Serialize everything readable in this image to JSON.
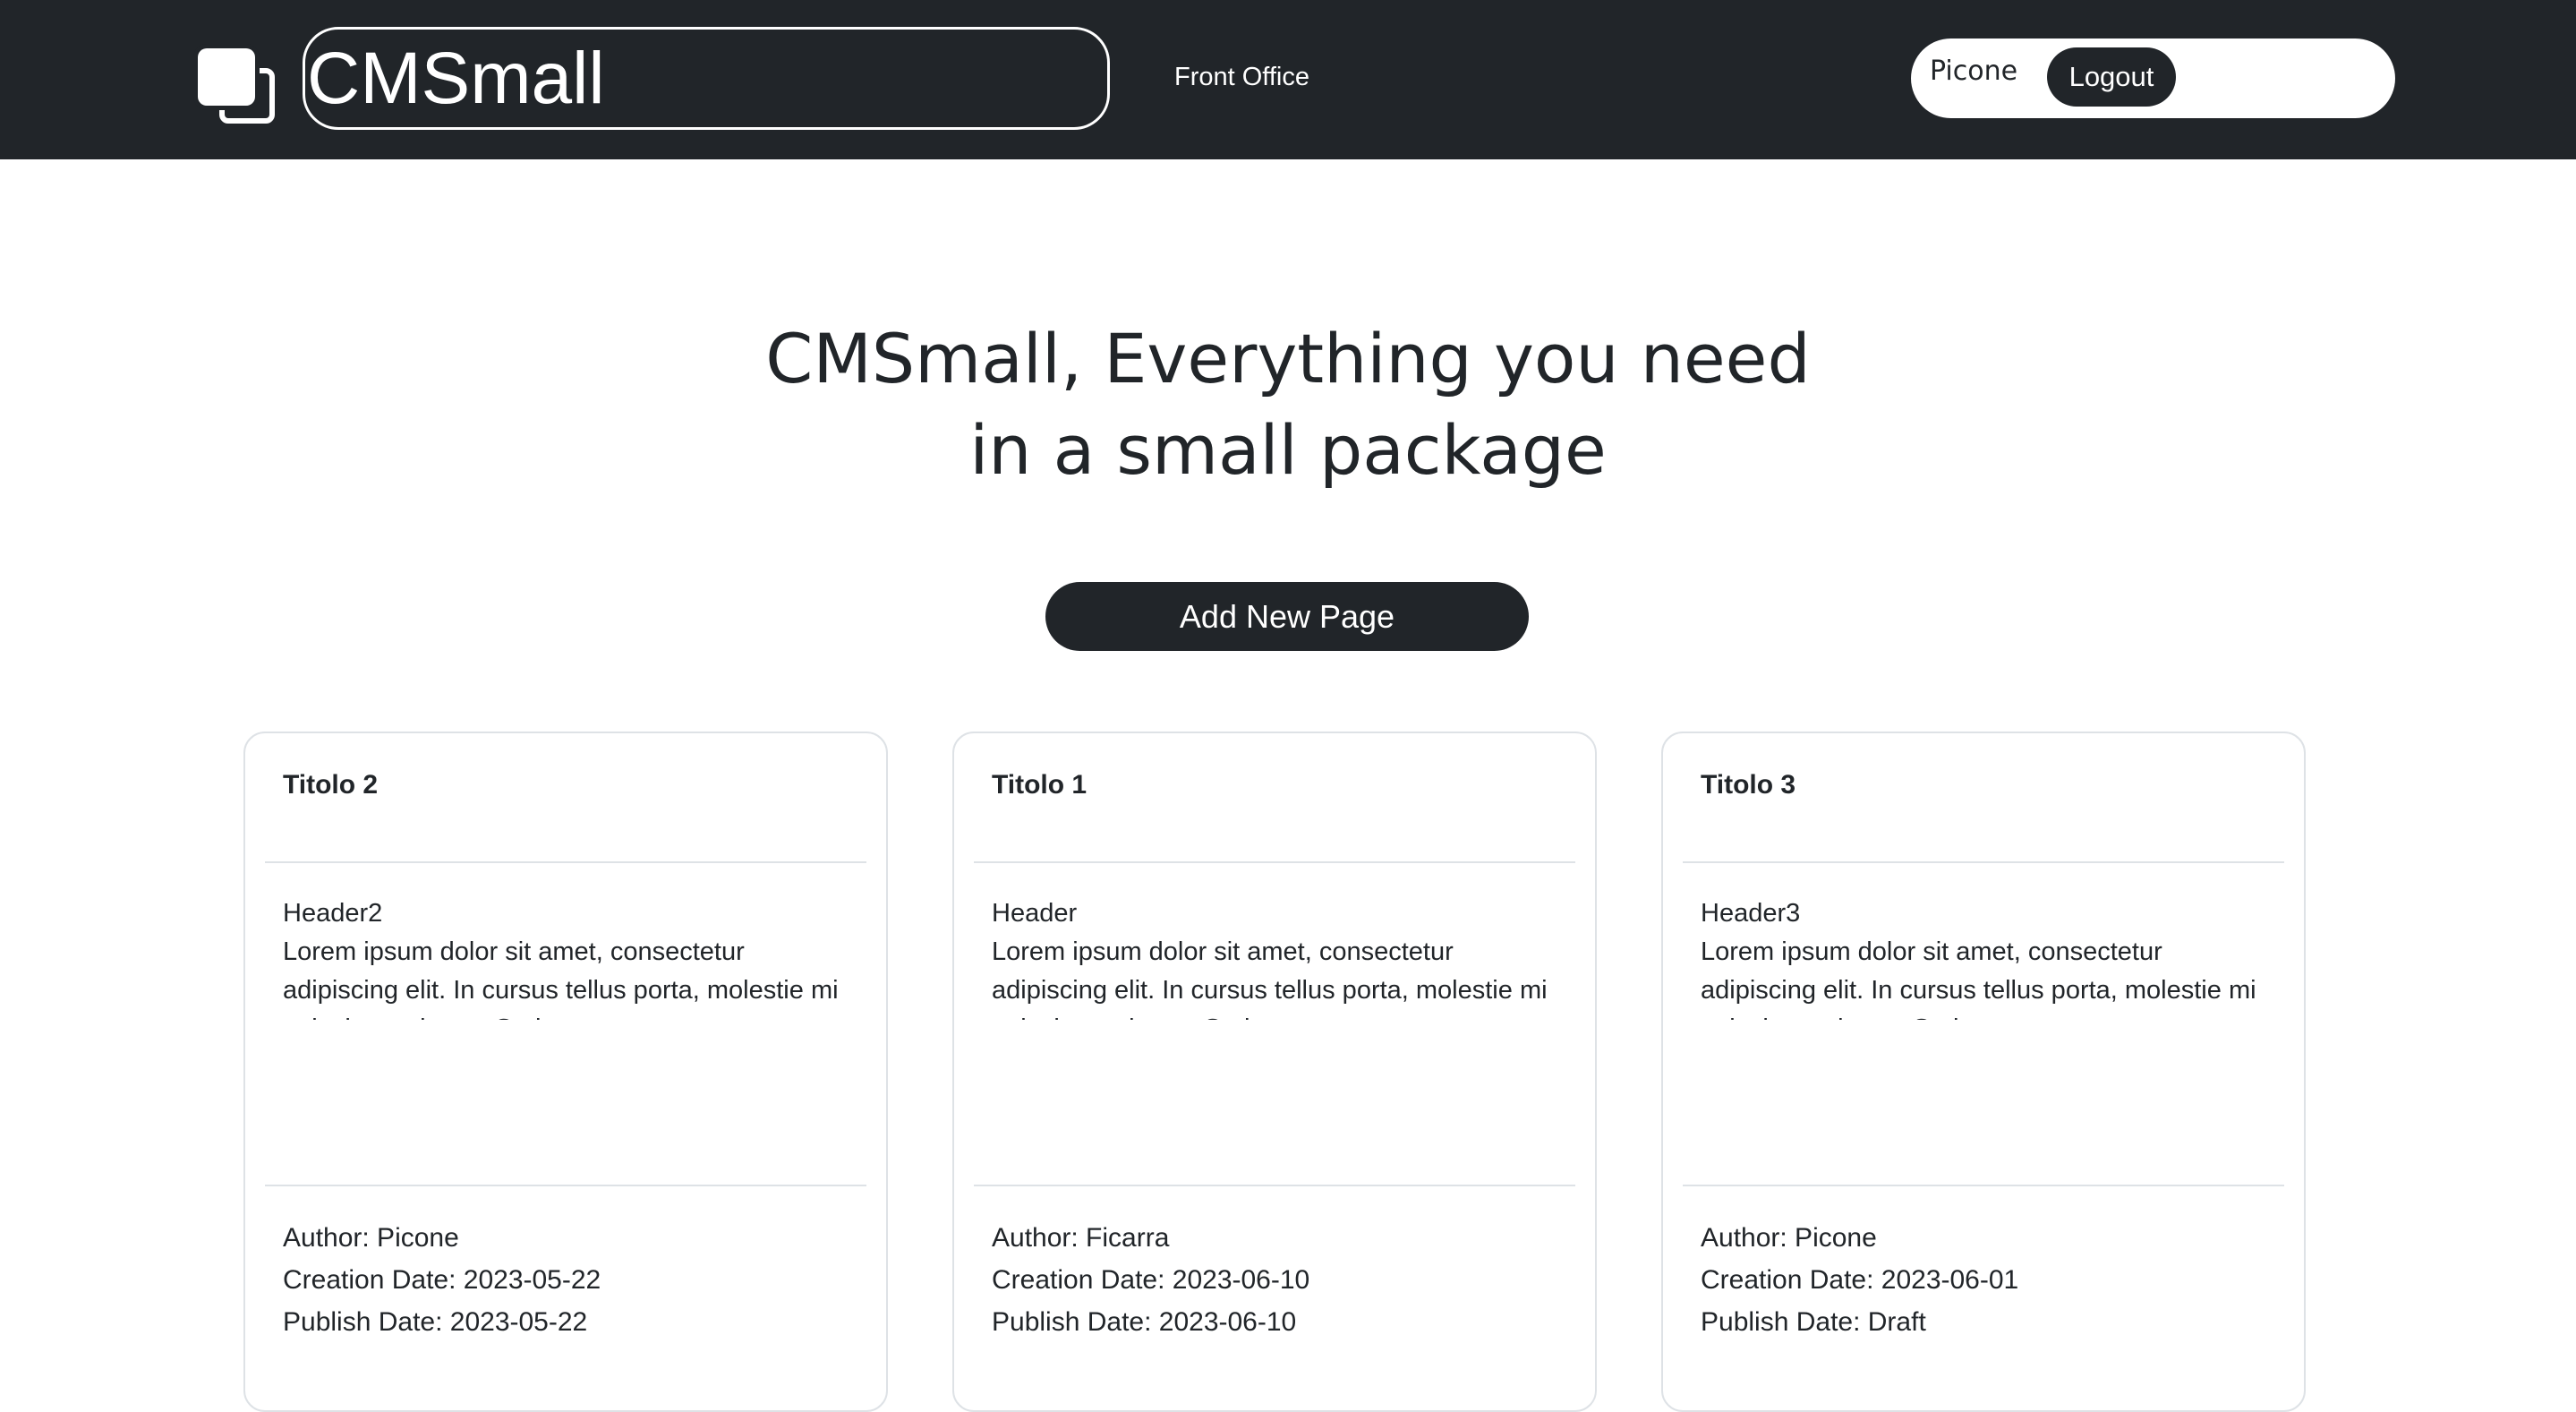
{
  "navbar": {
    "brand": "CMSmall",
    "front_office": "Front Office",
    "username": "Picone",
    "logout": "Logout"
  },
  "hero": {
    "line1": "CMSmall, Everything you need",
    "line2": "in a small package"
  },
  "add_button": "Add New Page",
  "cards": [
    {
      "title": "Titolo 2",
      "header": "Header2",
      "text": "Lorem ipsum dolor sit amet, consectetur adipiscing elit. In cursus tellus porta, molestie mi quis, luctus lacus. Sed non egestas purus, eget interdum lectus. Aliquam ultricies magna in ex congue, sit amet suscipit ex pellentesque. Integer ullamcorper nibh a ultricies lobortis. Curabitur enim tortor, lacinia sit amet est quis",
      "author": "Author: Picone",
      "creation": "Creation Date: 2023-05-22",
      "publish": "Publish Date: 2023-05-22"
    },
    {
      "title": "Titolo 1",
      "header": "Header",
      "text": "Lorem ipsum dolor sit amet, consectetur adipiscing elit. In cursus tellus porta, molestie mi quis, luctus lacus. Sed non egestas purus, eget interdum lectus. Aliquam ultricies magna in ex congue, sit amet suscipit ex pellentesque. Integer ullamcorper nibh a ultricies lobortis. Curabitur enim tortor, lacinia sit amet est quis",
      "author": "Author: Ficarra",
      "creation": "Creation Date: 2023-06-10",
      "publish": "Publish Date: 2023-06-10"
    },
    {
      "title": "Titolo 3",
      "header": "Header3",
      "text": "Lorem ipsum dolor sit amet, consectetur adipiscing elit. In cursus tellus porta, molestie mi quis, luctus lacus. Sed non egestas purus, eget interdum lectus. Aliquam ultricies magna in ex congue, sit amet suscipit ex pellentesque. Integer ullamcorper nibh a ultricies lobortis. Curabitur enim tortor, lacinia sit amet est quis",
      "author": "Author: Picone",
      "creation": "Creation Date: 2023-06-01",
      "publish": "Publish Date: Draft"
    }
  ]
}
